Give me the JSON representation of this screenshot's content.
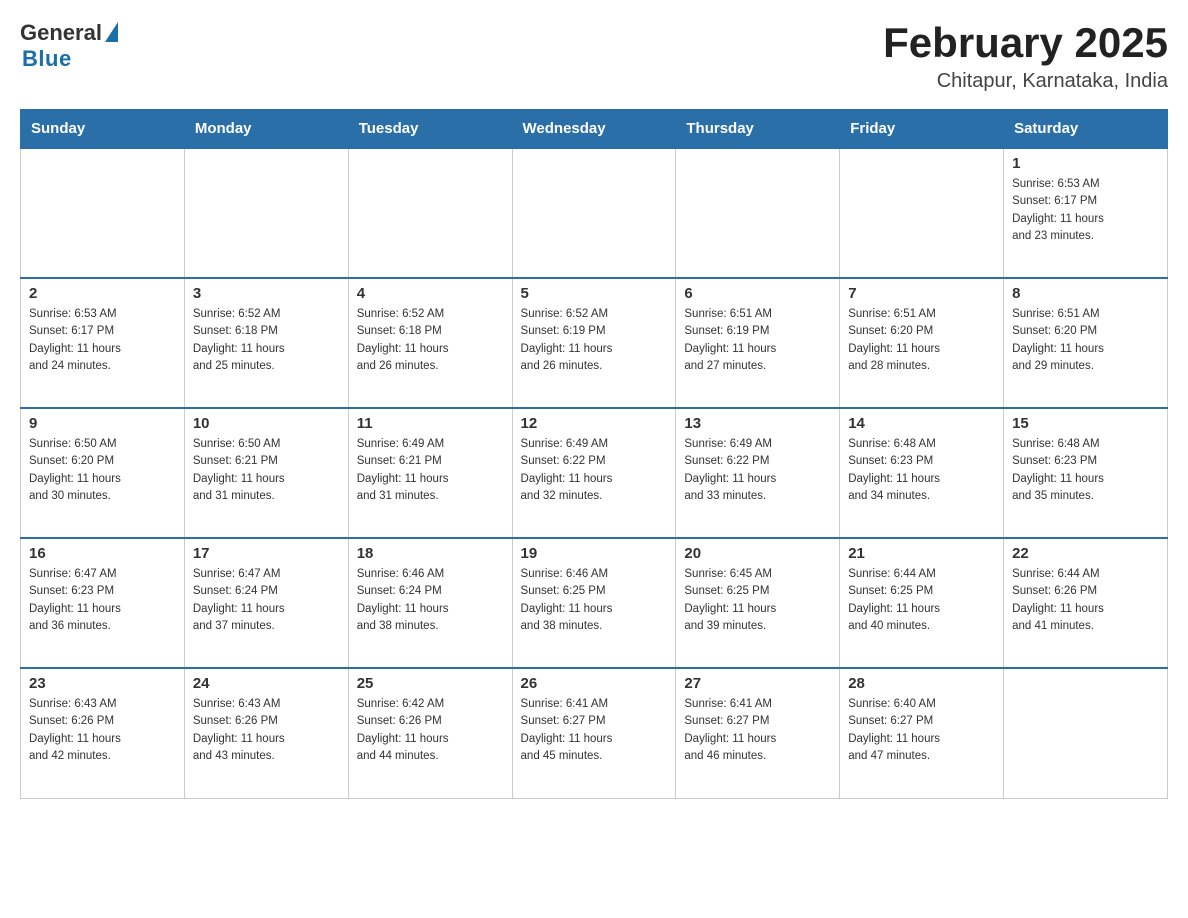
{
  "header": {
    "logo_general": "General",
    "logo_blue": "Blue",
    "month_year": "February 2025",
    "location": "Chitapur, Karnataka, India"
  },
  "weekdays": [
    "Sunday",
    "Monday",
    "Tuesday",
    "Wednesday",
    "Thursday",
    "Friday",
    "Saturday"
  ],
  "weeks": [
    [
      {
        "day": "",
        "info": ""
      },
      {
        "day": "",
        "info": ""
      },
      {
        "day": "",
        "info": ""
      },
      {
        "day": "",
        "info": ""
      },
      {
        "day": "",
        "info": ""
      },
      {
        "day": "",
        "info": ""
      },
      {
        "day": "1",
        "info": "Sunrise: 6:53 AM\nSunset: 6:17 PM\nDaylight: 11 hours\nand 23 minutes."
      }
    ],
    [
      {
        "day": "2",
        "info": "Sunrise: 6:53 AM\nSunset: 6:17 PM\nDaylight: 11 hours\nand 24 minutes."
      },
      {
        "day": "3",
        "info": "Sunrise: 6:52 AM\nSunset: 6:18 PM\nDaylight: 11 hours\nand 25 minutes."
      },
      {
        "day": "4",
        "info": "Sunrise: 6:52 AM\nSunset: 6:18 PM\nDaylight: 11 hours\nand 26 minutes."
      },
      {
        "day": "5",
        "info": "Sunrise: 6:52 AM\nSunset: 6:19 PM\nDaylight: 11 hours\nand 26 minutes."
      },
      {
        "day": "6",
        "info": "Sunrise: 6:51 AM\nSunset: 6:19 PM\nDaylight: 11 hours\nand 27 minutes."
      },
      {
        "day": "7",
        "info": "Sunrise: 6:51 AM\nSunset: 6:20 PM\nDaylight: 11 hours\nand 28 minutes."
      },
      {
        "day": "8",
        "info": "Sunrise: 6:51 AM\nSunset: 6:20 PM\nDaylight: 11 hours\nand 29 minutes."
      }
    ],
    [
      {
        "day": "9",
        "info": "Sunrise: 6:50 AM\nSunset: 6:20 PM\nDaylight: 11 hours\nand 30 minutes."
      },
      {
        "day": "10",
        "info": "Sunrise: 6:50 AM\nSunset: 6:21 PM\nDaylight: 11 hours\nand 31 minutes."
      },
      {
        "day": "11",
        "info": "Sunrise: 6:49 AM\nSunset: 6:21 PM\nDaylight: 11 hours\nand 31 minutes."
      },
      {
        "day": "12",
        "info": "Sunrise: 6:49 AM\nSunset: 6:22 PM\nDaylight: 11 hours\nand 32 minutes."
      },
      {
        "day": "13",
        "info": "Sunrise: 6:49 AM\nSunset: 6:22 PM\nDaylight: 11 hours\nand 33 minutes."
      },
      {
        "day": "14",
        "info": "Sunrise: 6:48 AM\nSunset: 6:23 PM\nDaylight: 11 hours\nand 34 minutes."
      },
      {
        "day": "15",
        "info": "Sunrise: 6:48 AM\nSunset: 6:23 PM\nDaylight: 11 hours\nand 35 minutes."
      }
    ],
    [
      {
        "day": "16",
        "info": "Sunrise: 6:47 AM\nSunset: 6:23 PM\nDaylight: 11 hours\nand 36 minutes."
      },
      {
        "day": "17",
        "info": "Sunrise: 6:47 AM\nSunset: 6:24 PM\nDaylight: 11 hours\nand 37 minutes."
      },
      {
        "day": "18",
        "info": "Sunrise: 6:46 AM\nSunset: 6:24 PM\nDaylight: 11 hours\nand 38 minutes."
      },
      {
        "day": "19",
        "info": "Sunrise: 6:46 AM\nSunset: 6:25 PM\nDaylight: 11 hours\nand 38 minutes."
      },
      {
        "day": "20",
        "info": "Sunrise: 6:45 AM\nSunset: 6:25 PM\nDaylight: 11 hours\nand 39 minutes."
      },
      {
        "day": "21",
        "info": "Sunrise: 6:44 AM\nSunset: 6:25 PM\nDaylight: 11 hours\nand 40 minutes."
      },
      {
        "day": "22",
        "info": "Sunrise: 6:44 AM\nSunset: 6:26 PM\nDaylight: 11 hours\nand 41 minutes."
      }
    ],
    [
      {
        "day": "23",
        "info": "Sunrise: 6:43 AM\nSunset: 6:26 PM\nDaylight: 11 hours\nand 42 minutes."
      },
      {
        "day": "24",
        "info": "Sunrise: 6:43 AM\nSunset: 6:26 PM\nDaylight: 11 hours\nand 43 minutes."
      },
      {
        "day": "25",
        "info": "Sunrise: 6:42 AM\nSunset: 6:26 PM\nDaylight: 11 hours\nand 44 minutes."
      },
      {
        "day": "26",
        "info": "Sunrise: 6:41 AM\nSunset: 6:27 PM\nDaylight: 11 hours\nand 45 minutes."
      },
      {
        "day": "27",
        "info": "Sunrise: 6:41 AM\nSunset: 6:27 PM\nDaylight: 11 hours\nand 46 minutes."
      },
      {
        "day": "28",
        "info": "Sunrise: 6:40 AM\nSunset: 6:27 PM\nDaylight: 11 hours\nand 47 minutes."
      },
      {
        "day": "",
        "info": ""
      }
    ]
  ]
}
